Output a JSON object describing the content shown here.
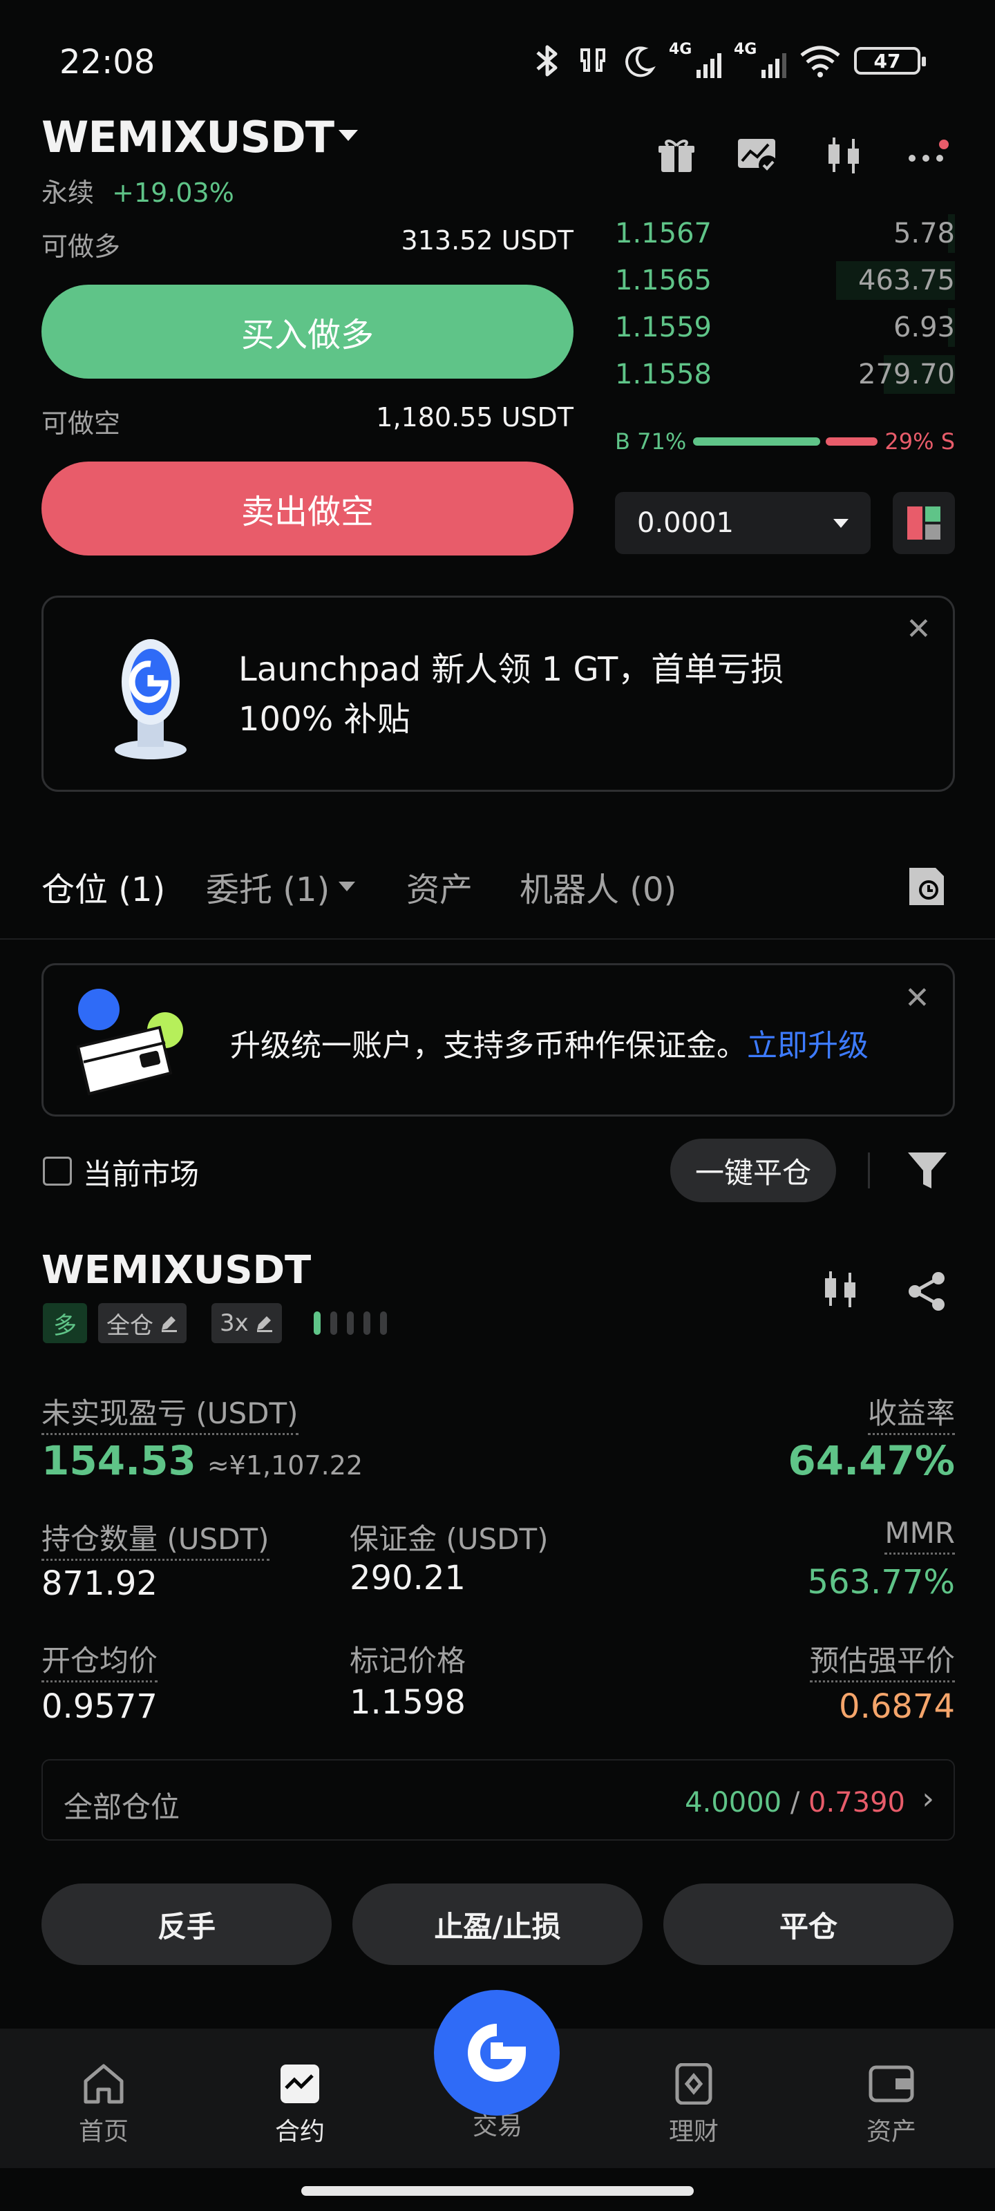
{
  "status_bar": {
    "time": "22:08",
    "battery": "47",
    "net1": "4G",
    "net2": "4G"
  },
  "header": {
    "symbol": "WEMIXUSDT",
    "contract_type": "永续",
    "change": "+19.03%"
  },
  "order_panel": {
    "long_label": "可做多",
    "long_available": "313.52 USDT",
    "buy_button": "买入做多",
    "short_label": "可做空",
    "short_available": "1,180.55 USDT",
    "sell_button": "卖出做空"
  },
  "order_book": {
    "rows": [
      {
        "price": "1.1567",
        "amount": "5.78",
        "depth": 0.02
      },
      {
        "price": "1.1565",
        "amount": "463.75",
        "depth": 0.35
      },
      {
        "price": "1.1559",
        "amount": "6.93",
        "depth": 0.02
      },
      {
        "price": "1.1558",
        "amount": "279.70",
        "depth": 0.21
      }
    ],
    "buy_ratio_label": "B 71%",
    "sell_ratio_label": "29% S",
    "buy_ratio": 0.71,
    "precision": "0.0001"
  },
  "banner": {
    "line1": "Launchpad 新人领 1 GT，首单亏损",
    "line2": "100% 补贴"
  },
  "tabs": [
    {
      "label": "仓位 (1)"
    },
    {
      "label": "委托 (1)"
    },
    {
      "label": "资产"
    },
    {
      "label": "机器人 (0)"
    }
  ],
  "upgrade": {
    "text": "升级统一账户，支持多币种作保证金。",
    "link": "立即升级"
  },
  "filter": {
    "current_market": "当前市场",
    "close_all": "一键平仓"
  },
  "position": {
    "symbol": "WEMIXUSDT",
    "side": "多",
    "margin_mode": "全仓",
    "leverage": "3x",
    "unrealized_pnl_label": "未实现盈亏 (USDT)",
    "unrealized_pnl": "154.53",
    "unrealized_pnl_cny": "≈¥1,107.22",
    "roe_label": "收益率",
    "roe": "64.47%",
    "size_label": "持仓数量 (USDT)",
    "size": "871.92",
    "margin_label": "保证金 (USDT)",
    "margin": "290.21",
    "mmr_label": "MMR",
    "mmr": "563.77%",
    "entry_label": "开仓均价",
    "entry": "0.9577",
    "mark_label": "标记价格",
    "mark": "1.1598",
    "liq_label": "预估强平价",
    "liq": "0.6874",
    "all_positions_label": "全部仓位",
    "all_positions_green": "4.0000",
    "all_positions_sep": " / ",
    "all_positions_red": "0.7390"
  },
  "actions": {
    "reverse": "反手",
    "tp_sl": "止盈/止损",
    "close": "平仓"
  },
  "nav": {
    "home": "首页",
    "futures": "合约",
    "trade": "交易",
    "earn": "理财",
    "assets": "资产"
  },
  "colors": {
    "green": "#5fc488",
    "red": "#e85c6a",
    "blue": "#3d7bff",
    "orange": "#f5a56b",
    "fab": "#2f6bf7"
  }
}
